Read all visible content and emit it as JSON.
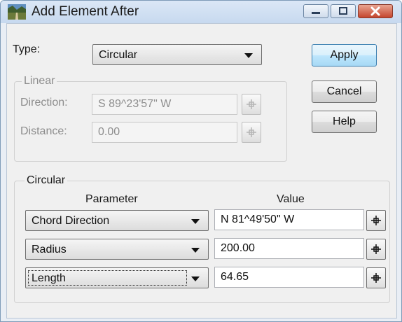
{
  "window": {
    "title": "Add Element After",
    "icon": "road-landscape-icon"
  },
  "type": {
    "label": "Type:",
    "selected": "Circular"
  },
  "buttons": {
    "apply": "Apply",
    "cancel": "Cancel",
    "help": "Help"
  },
  "linear": {
    "group_label": "Linear",
    "direction_label": "Direction:",
    "direction_value": "S 89^23'57\" W",
    "distance_label": "Distance:",
    "distance_value": "0.00"
  },
  "circular": {
    "group_label": "Circular",
    "parameter_header": "Parameter",
    "value_header": "Value",
    "rows": [
      {
        "parameter": "Chord Direction",
        "value": "N 81^49'50\" W"
      },
      {
        "parameter": "Radius",
        "value": "200.00"
      },
      {
        "parameter": "Length",
        "value": "64.65"
      }
    ]
  },
  "colors": {
    "default_button": "#bee6fd",
    "close_button": "#c4452d",
    "disabled_text": "#8d8d8d"
  }
}
